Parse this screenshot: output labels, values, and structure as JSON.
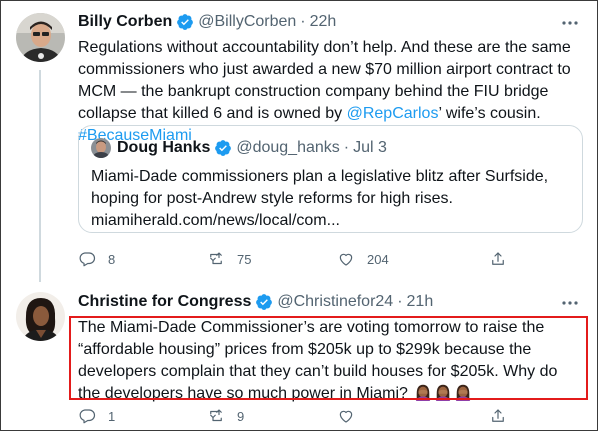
{
  "tweet1": {
    "name": "Billy Corben",
    "handle": "@BillyCorben",
    "separator": "·",
    "time": "22h",
    "more_icon": "more-dots-icon",
    "text_1": "Regulations without accountability don’t help. And these are the same commissioners who just awarded a new $70 million airport contract to MCM — the bankrupt construction company behind the FIU bridge collapse that killed 6 and is owned by ",
    "mention": "@RepCarlos",
    "text_2": "’ wife’s cousin. ",
    "hashtag": "#BecauseMiami",
    "quote": {
      "name": "Doug Hanks",
      "handle": "@doug_hanks",
      "separator": "·",
      "time": "Jul 3",
      "text": "Miami-Dade commissioners plan a legislative blitz after Surfside, hoping for post-Andrew style reforms for high rises.",
      "url": "miamiherald.com/news/local/com..."
    },
    "actions": {
      "replies": "8",
      "retweets": "75",
      "likes": "204"
    }
  },
  "tweet2": {
    "name": "Christine for Congress",
    "handle": "@Christinefor24",
    "separator": "·",
    "time": "21h",
    "more_icon": "more-dots-icon",
    "text": "The Miami-Dade Commissioner’s are voting tomorrow to raise the “affordable housing” prices from $205k up to $299k because the developers complain that they can’t build houses for $205k. Why do the developers have so much power in Miami?",
    "emojis": [
      "woman-facepalming-icon",
      "woman-facepalming-icon",
      "woman-facepalming-icon"
    ],
    "actions": {
      "replies": "1",
      "retweets": "9",
      "likes": ""
    }
  },
  "colors": {
    "link": "#1d9bf0",
    "verified": "#1d9bf0",
    "highlight_border": "#e31b1b",
    "secondary_text": "#536471"
  }
}
